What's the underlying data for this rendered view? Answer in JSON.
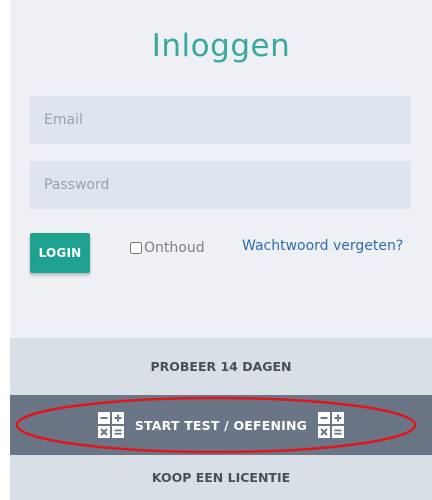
{
  "login": {
    "title": "Inloggen",
    "email_placeholder": "Email",
    "password_placeholder": "Password",
    "login_button": "LOGIN",
    "remember_label": "Onthoud",
    "forgot_link": "Wachtwoord vergeten?"
  },
  "actions": {
    "try": "PROBEER 14 DAGEN",
    "start": "START TEST / OEFENING",
    "buy": "KOOP EEN LICENTIE"
  },
  "colors": {
    "accent": "#1fa18f",
    "title": "#3aa99d",
    "highlight_ellipse": "#e0161c"
  }
}
